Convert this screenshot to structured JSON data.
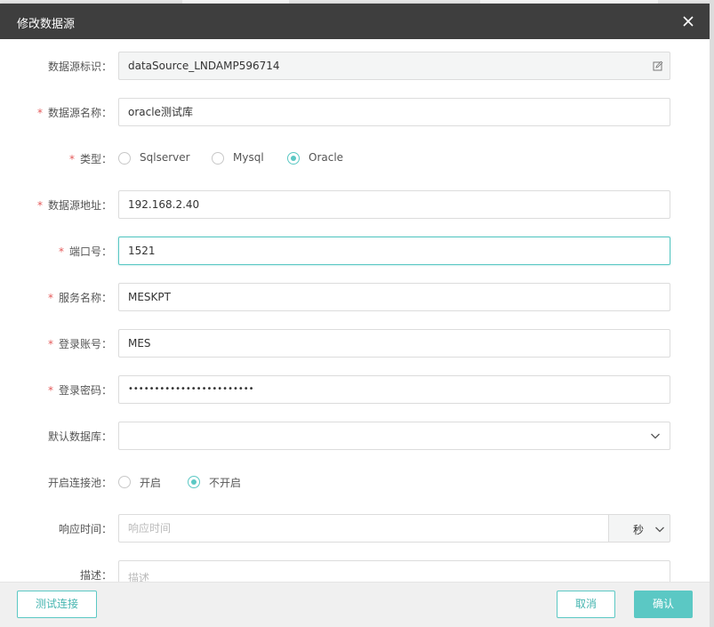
{
  "dialog": {
    "title": "修改数据源"
  },
  "form": {
    "datasource_id": {
      "label": "数据源标识：",
      "value": "dataSource_LNDAMP596714"
    },
    "datasource_name": {
      "label": "数据源名称：",
      "value": "oracle测试库",
      "required": "*"
    },
    "type": {
      "label": "类型：",
      "required": "*",
      "options": [
        "Sqlserver",
        "Mysql",
        "Oracle"
      ],
      "selected": "Oracle"
    },
    "address": {
      "label": "数据源地址：",
      "value": "192.168.2.40",
      "required": "*"
    },
    "port": {
      "label": "端口号：",
      "value": "1521",
      "required": "*"
    },
    "service_name": {
      "label": "服务名称：",
      "value": "MESKPT",
      "required": "*"
    },
    "account": {
      "label": "登录账号：",
      "value": "MES",
      "required": "*"
    },
    "password": {
      "label": "登录密码：",
      "value": "••••••••••••••••••••••••",
      "required": "*"
    },
    "default_db": {
      "label": "默认数据库：",
      "value": ""
    },
    "pool": {
      "label": "开启连接池：",
      "options": [
        "开启",
        "不开启"
      ],
      "selected": "不开启"
    },
    "response_time": {
      "label": "响应时间：",
      "placeholder": "响应时间",
      "unit": "秒"
    },
    "description": {
      "label": "描述：",
      "placeholder": "描述"
    }
  },
  "footer": {
    "test_label": "测试连接",
    "cancel_label": "取消",
    "confirm_label": "确认"
  },
  "colors": {
    "accent": "#5bc8c4",
    "titlebar": "#3e3e3e",
    "required": "#e45a5a"
  }
}
